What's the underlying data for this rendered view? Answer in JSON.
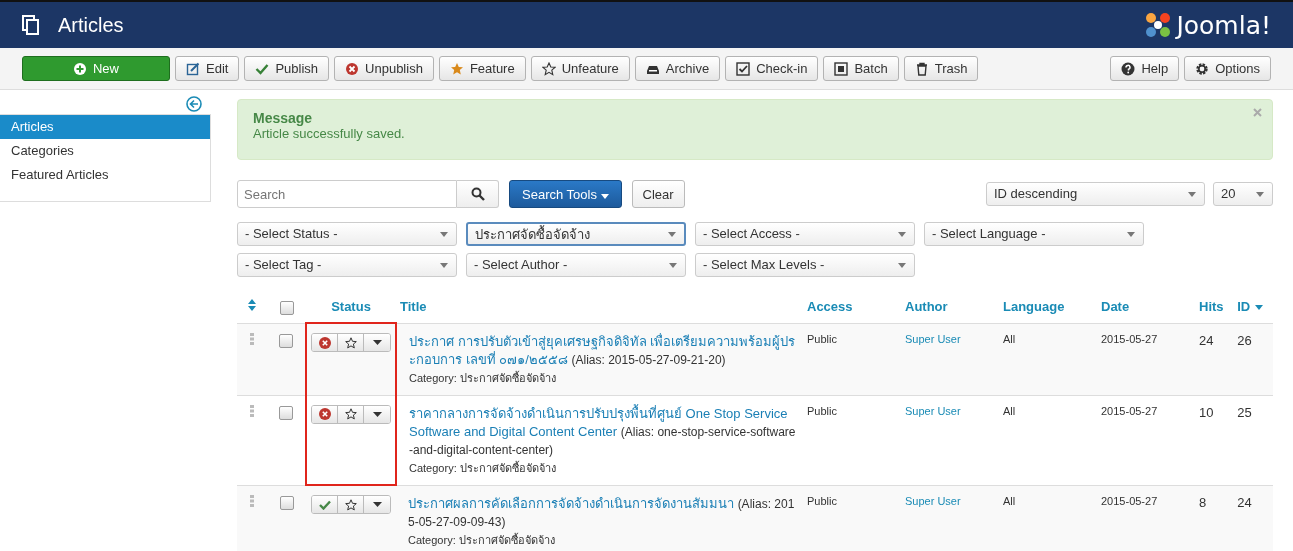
{
  "header": {
    "title": "Articles",
    "logo": "Joomla!"
  },
  "toolbar": [
    {
      "label": "New",
      "kind": "new"
    },
    {
      "label": "Edit",
      "kind": "edit"
    },
    {
      "label": "Publish",
      "kind": "publish"
    },
    {
      "label": "Unpublish",
      "kind": "unpublish"
    },
    {
      "label": "Feature",
      "kind": "feature"
    },
    {
      "label": "Unfeature",
      "kind": "unfeature"
    },
    {
      "label": "Archive",
      "kind": "archive"
    },
    {
      "label": "Check-in",
      "kind": "checkin"
    },
    {
      "label": "Batch",
      "kind": "batch"
    },
    {
      "label": "Trash",
      "kind": "trash"
    }
  ],
  "toolbar_right": [
    {
      "label": "Help",
      "kind": "help"
    },
    {
      "label": "Options",
      "kind": "options"
    }
  ],
  "sidebar": {
    "items": [
      {
        "label": "Articles",
        "selected": true
      },
      {
        "label": "Categories",
        "selected": false
      },
      {
        "label": "Featured Articles",
        "selected": false
      }
    ]
  },
  "message": {
    "heading": "Message",
    "text": "Article successfully saved."
  },
  "search": {
    "placeholder": "Search",
    "tools_button": "Search Tools",
    "clear_button": "Clear",
    "ordering": "ID descending",
    "limit": "20"
  },
  "filters": [
    {
      "value": "- Select Status -",
      "focused": false
    },
    {
      "value": "ประกาศจัดซื้อจัดจ้าง",
      "focused": true
    },
    {
      "value": "- Select Access -",
      "focused": false
    },
    {
      "value": "- Select Language -",
      "focused": false
    },
    {
      "value": "- Select Tag -",
      "focused": false
    },
    {
      "value": "- Select Author -",
      "focused": false
    },
    {
      "value": "- Select Max Levels -",
      "focused": false
    }
  ],
  "table": {
    "select_all_checked": false,
    "columns": [
      "Status",
      "Title",
      "Access",
      "Author",
      "Language",
      "Date",
      "Hits",
      "ID"
    ],
    "rows": [
      {
        "checked": false,
        "published": false,
        "featured": false,
        "highlighted": true,
        "title": "ประกาศ การปรับตัวเข้าสู่ยุคเศรษฐกิจดิจิทัล เพื่อเตรียมความพร้อมผู้ประกอบการ เลขที่ ๐๗๑/๒๕๕๘",
        "alias": "(Alias: 2015-05-27-09-21-20)",
        "category": "Category: ประกาศจัดซื้อจัดจ้าง",
        "access": "Public",
        "author": "Super User",
        "language": "All",
        "date": "2015-05-27",
        "hits": "24",
        "id": "26"
      },
      {
        "checked": false,
        "published": false,
        "featured": false,
        "highlighted": true,
        "title": "ราคากลางการจัดจ้างดำเนินการปรับปรุงพื้นที่ศูนย์ One Stop Service Software and Digital Content Center",
        "alias": "(Alias: one-stop-service-software-and-digital-content-center)",
        "category": "Category: ประกาศจัดซื้อจัดจ้าง",
        "access": "Public",
        "author": "Super User",
        "language": "All",
        "date": "2015-05-27",
        "hits": "10",
        "id": "25"
      },
      {
        "checked": false,
        "published": true,
        "featured": false,
        "highlighted": false,
        "title": "ประกาศผลการคัดเลือกการจัดจ้างดำเนินการจัดงานสัมมนา",
        "alias": "(Alias: 2015-05-27-09-09-43)",
        "category": "Category: ประกาศจัดซื้อจัดจ้าง",
        "access": "Public",
        "author": "Super User",
        "language": "All",
        "date": "2015-05-27",
        "hits": "8",
        "id": "24"
      }
    ]
  }
}
